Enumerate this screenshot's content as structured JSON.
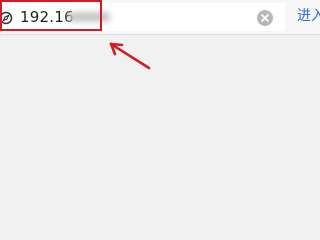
{
  "address_bar": {
    "url_text": "192.16",
    "clear_icon": "clear-circle-x-icon",
    "site_icon": "globe-icon",
    "go_label": "进入"
  },
  "annotation": {
    "color": "#d01c24"
  },
  "colors": {
    "page_background": "#f1f1f1",
    "go_button": "#2f6fd6"
  }
}
